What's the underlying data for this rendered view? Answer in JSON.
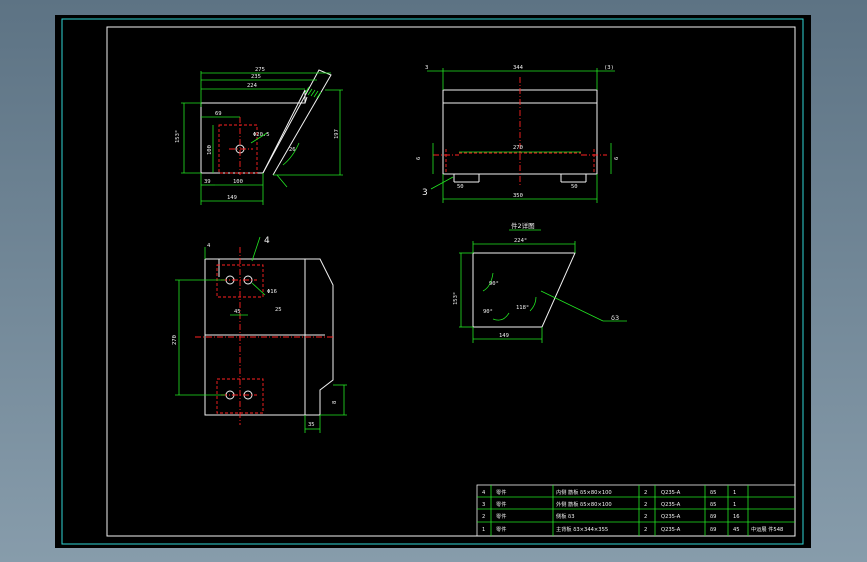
{
  "colors": {
    "background": "#000000",
    "border": "#2fd6d6",
    "part_lines": "#f2f2f2",
    "dimension_lines": "#22e622",
    "center_lines": "#ff2222"
  },
  "front_view": {
    "dims": {
      "top1": "275",
      "top2": "235",
      "top3": "224",
      "left_height": "153°",
      "inner_left": "100",
      "right_height": "197",
      "offset_left": "69",
      "hole_dia": "Φ20.5",
      "slot_label": "26",
      "bottom_left": "39",
      "bottom_mid": "100",
      "bottom_total": "149"
    }
  },
  "side_view": {
    "dims": {
      "left_small": "3",
      "top_total": "344",
      "right_small": "(3)",
      "inner_width": "270",
      "left_height": "6",
      "right_height": "6",
      "foot_left": "50",
      "foot_right": "50",
      "bottom_total": "350"
    },
    "callout": "3"
  },
  "plan_view": {
    "callout": "4",
    "dims": {
      "corner": "4",
      "hole_dia": "Φ16",
      "hole_spacing": "45",
      "hole_offset": "25",
      "total_length": "270",
      "right_height": "8",
      "bottom_offset": "35"
    }
  },
  "detail_view": {
    "title": "件2详图",
    "dims": {
      "top": "224°",
      "left": "153°",
      "angle_left": "90°",
      "angle_bottom": "90°",
      "angle_right": "118°",
      "bottom": "149",
      "leader": "δ3"
    }
  },
  "title_block": {
    "rows": [
      {
        "no": "4",
        "type": "零件",
        "name": "内侧 筋板 δ5×80×100",
        "qty": "2",
        "material": "Q235-A",
        "thk": "δ5",
        "count": "1",
        "note": ""
      },
      {
        "no": "3",
        "type": "零件",
        "name": "外侧 筋板 δ5×80×100",
        "qty": "2",
        "material": "Q235-A",
        "thk": "δ5",
        "count": "1",
        "note": ""
      },
      {
        "no": "2",
        "type": "零件",
        "name": "侧板 δ3",
        "qty": "2",
        "material": "Q235-A",
        "thk": "δ9",
        "count": "16",
        "note": ""
      },
      {
        "no": "1",
        "type": "零件",
        "name": "主背板 δ3×344×355",
        "qty": "2",
        "material": "Q235-A",
        "thk": "δ9",
        "count": "45",
        "note": "中运展 件548"
      }
    ]
  }
}
